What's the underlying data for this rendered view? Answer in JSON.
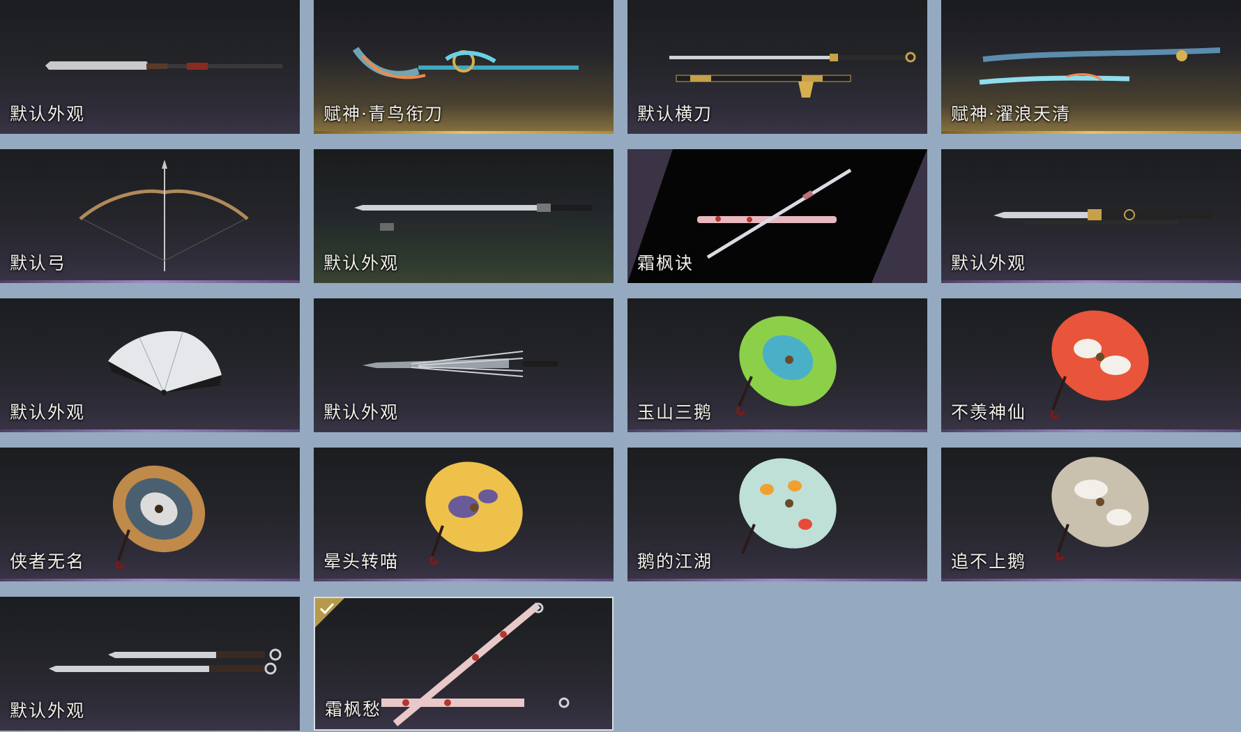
{
  "items": [
    {
      "label": "默认外观"
    },
    {
      "label": "赋神·青鸟衔刀"
    },
    {
      "label": "默认横刀"
    },
    {
      "label": "赋神·濯浪天清"
    },
    {
      "label": "默认弓"
    },
    {
      "label": "默认外观"
    },
    {
      "label": "霜枫诀"
    },
    {
      "label": "默认外观"
    },
    {
      "label": "默认外观"
    },
    {
      "label": "默认外观"
    },
    {
      "label": "玉山三鹅"
    },
    {
      "label": "不羡神仙"
    },
    {
      "label": "侠者无名"
    },
    {
      "label": "晕头转喵"
    },
    {
      "label": "鹅的江湖"
    },
    {
      "label": "追不上鹅"
    },
    {
      "label": "默认外观"
    },
    {
      "label": "霜枫愁",
      "selected": true
    }
  ],
  "colors": {
    "background": "#95aac0",
    "card": "#232428",
    "gold_accent": "#e8c261",
    "purple_accent": "#9c8cc4",
    "label": "#f3f0ea"
  }
}
